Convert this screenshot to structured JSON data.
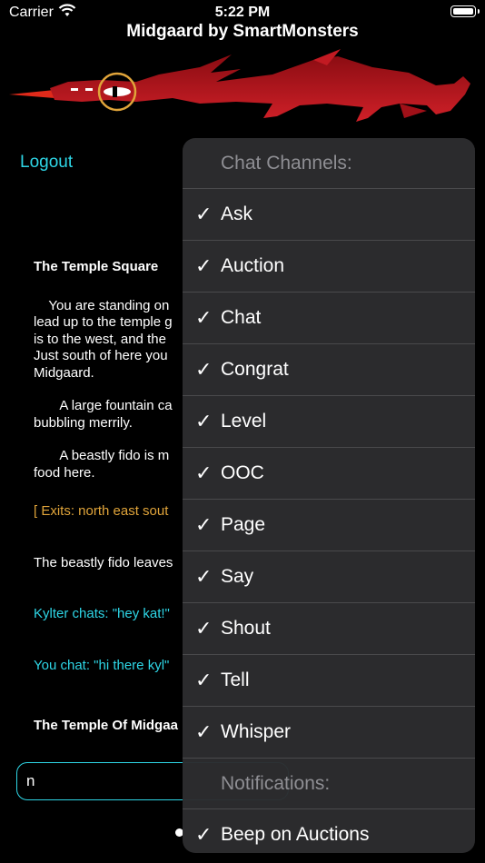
{
  "status_bar": {
    "carrier": "Carrier",
    "time": "5:22 PM"
  },
  "app": {
    "title": "Midgaard by SmartMonsters"
  },
  "logout_label": "Logout",
  "log": [
    {
      "type": "room-title",
      "text": "The Temple Square"
    },
    {
      "type": "text",
      "text": "    You are standing on"
    },
    {
      "type": "text",
      "text": "lead up to the temple g"
    },
    {
      "type": "text",
      "text": "is to the west, and the"
    },
    {
      "type": "text",
      "text": "Just south of here you"
    },
    {
      "type": "text",
      "text": "Midgaard."
    },
    {
      "type": "text",
      "text": "       A large fountain ca"
    },
    {
      "type": "text",
      "text": "bubbling merrily."
    },
    {
      "type": "text",
      "text": "       A beastly fido is m"
    },
    {
      "type": "text",
      "text": "food here."
    },
    {
      "type": "exits",
      "text": "[ Exits: north east sout"
    },
    {
      "type": "text",
      "text": "The beastly fido leaves"
    },
    {
      "type": "chat",
      "text": "Kylter chats: \"hey kat!\""
    },
    {
      "type": "chat",
      "text": "You chat: \"hi there kyl\""
    },
    {
      "type": "room-title",
      "text": "The Temple Of Midgaa"
    }
  ],
  "command_input": {
    "value": "n"
  },
  "menu": {
    "chat_channels_header": "Chat Channels:",
    "channels": [
      {
        "label": "Ask",
        "checked": true
      },
      {
        "label": "Auction",
        "checked": true
      },
      {
        "label": "Chat",
        "checked": true
      },
      {
        "label": "Congrat",
        "checked": true
      },
      {
        "label": "Level",
        "checked": true
      },
      {
        "label": "OOC",
        "checked": true
      },
      {
        "label": "Page",
        "checked": true
      },
      {
        "label": "Say",
        "checked": true
      },
      {
        "label": "Shout",
        "checked": true
      },
      {
        "label": "Tell",
        "checked": true
      },
      {
        "label": "Whisper",
        "checked": true
      }
    ],
    "notifications_header": "Notifications:",
    "notifications": [
      {
        "label": "Beep on Auctions",
        "checked": true
      }
    ],
    "check_glyph": "✓"
  },
  "colors": {
    "accent": "#2ed6e6",
    "exits": "#e0a43a",
    "dragon": "#b8141c",
    "eye_ring": "#e0a43a"
  }
}
